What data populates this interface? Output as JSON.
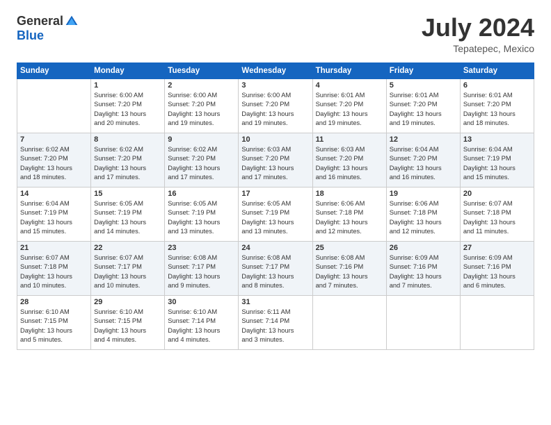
{
  "logo": {
    "general": "General",
    "blue": "Blue"
  },
  "title": "July 2024",
  "location": "Tepatepec, Mexico",
  "days_header": [
    "Sunday",
    "Monday",
    "Tuesday",
    "Wednesday",
    "Thursday",
    "Friday",
    "Saturday"
  ],
  "weeks": [
    [
      {
        "day": "",
        "info": ""
      },
      {
        "day": "1",
        "info": "Sunrise: 6:00 AM\nSunset: 7:20 PM\nDaylight: 13 hours\nand 20 minutes."
      },
      {
        "day": "2",
        "info": "Sunrise: 6:00 AM\nSunset: 7:20 PM\nDaylight: 13 hours\nand 19 minutes."
      },
      {
        "day": "3",
        "info": "Sunrise: 6:00 AM\nSunset: 7:20 PM\nDaylight: 13 hours\nand 19 minutes."
      },
      {
        "day": "4",
        "info": "Sunrise: 6:01 AM\nSunset: 7:20 PM\nDaylight: 13 hours\nand 19 minutes."
      },
      {
        "day": "5",
        "info": "Sunrise: 6:01 AM\nSunset: 7:20 PM\nDaylight: 13 hours\nand 19 minutes."
      },
      {
        "day": "6",
        "info": "Sunrise: 6:01 AM\nSunset: 7:20 PM\nDaylight: 13 hours\nand 18 minutes."
      }
    ],
    [
      {
        "day": "7",
        "info": "Sunrise: 6:02 AM\nSunset: 7:20 PM\nDaylight: 13 hours\nand 18 minutes."
      },
      {
        "day": "8",
        "info": "Sunrise: 6:02 AM\nSunset: 7:20 PM\nDaylight: 13 hours\nand 17 minutes."
      },
      {
        "day": "9",
        "info": "Sunrise: 6:02 AM\nSunset: 7:20 PM\nDaylight: 13 hours\nand 17 minutes."
      },
      {
        "day": "10",
        "info": "Sunrise: 6:03 AM\nSunset: 7:20 PM\nDaylight: 13 hours\nand 17 minutes."
      },
      {
        "day": "11",
        "info": "Sunrise: 6:03 AM\nSunset: 7:20 PM\nDaylight: 13 hours\nand 16 minutes."
      },
      {
        "day": "12",
        "info": "Sunrise: 6:04 AM\nSunset: 7:20 PM\nDaylight: 13 hours\nand 16 minutes."
      },
      {
        "day": "13",
        "info": "Sunrise: 6:04 AM\nSunset: 7:19 PM\nDaylight: 13 hours\nand 15 minutes."
      }
    ],
    [
      {
        "day": "14",
        "info": "Sunrise: 6:04 AM\nSunset: 7:19 PM\nDaylight: 13 hours\nand 15 minutes."
      },
      {
        "day": "15",
        "info": "Sunrise: 6:05 AM\nSunset: 7:19 PM\nDaylight: 13 hours\nand 14 minutes."
      },
      {
        "day": "16",
        "info": "Sunrise: 6:05 AM\nSunset: 7:19 PM\nDaylight: 13 hours\nand 13 minutes."
      },
      {
        "day": "17",
        "info": "Sunrise: 6:05 AM\nSunset: 7:19 PM\nDaylight: 13 hours\nand 13 minutes."
      },
      {
        "day": "18",
        "info": "Sunrise: 6:06 AM\nSunset: 7:18 PM\nDaylight: 13 hours\nand 12 minutes."
      },
      {
        "day": "19",
        "info": "Sunrise: 6:06 AM\nSunset: 7:18 PM\nDaylight: 13 hours\nand 12 minutes."
      },
      {
        "day": "20",
        "info": "Sunrise: 6:07 AM\nSunset: 7:18 PM\nDaylight: 13 hours\nand 11 minutes."
      }
    ],
    [
      {
        "day": "21",
        "info": "Sunrise: 6:07 AM\nSunset: 7:18 PM\nDaylight: 13 hours\nand 10 minutes."
      },
      {
        "day": "22",
        "info": "Sunrise: 6:07 AM\nSunset: 7:17 PM\nDaylight: 13 hours\nand 10 minutes."
      },
      {
        "day": "23",
        "info": "Sunrise: 6:08 AM\nSunset: 7:17 PM\nDaylight: 13 hours\nand 9 minutes."
      },
      {
        "day": "24",
        "info": "Sunrise: 6:08 AM\nSunset: 7:17 PM\nDaylight: 13 hours\nand 8 minutes."
      },
      {
        "day": "25",
        "info": "Sunrise: 6:08 AM\nSunset: 7:16 PM\nDaylight: 13 hours\nand 7 minutes."
      },
      {
        "day": "26",
        "info": "Sunrise: 6:09 AM\nSunset: 7:16 PM\nDaylight: 13 hours\nand 7 minutes."
      },
      {
        "day": "27",
        "info": "Sunrise: 6:09 AM\nSunset: 7:16 PM\nDaylight: 13 hours\nand 6 minutes."
      }
    ],
    [
      {
        "day": "28",
        "info": "Sunrise: 6:10 AM\nSunset: 7:15 PM\nDaylight: 13 hours\nand 5 minutes."
      },
      {
        "day": "29",
        "info": "Sunrise: 6:10 AM\nSunset: 7:15 PM\nDaylight: 13 hours\nand 4 minutes."
      },
      {
        "day": "30",
        "info": "Sunrise: 6:10 AM\nSunset: 7:14 PM\nDaylight: 13 hours\nand 4 minutes."
      },
      {
        "day": "31",
        "info": "Sunrise: 6:11 AM\nSunset: 7:14 PM\nDaylight: 13 hours\nand 3 minutes."
      },
      {
        "day": "",
        "info": ""
      },
      {
        "day": "",
        "info": ""
      },
      {
        "day": "",
        "info": ""
      }
    ]
  ]
}
